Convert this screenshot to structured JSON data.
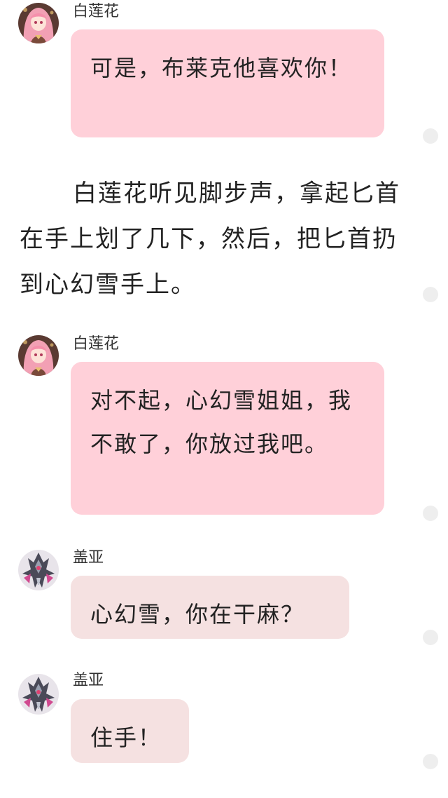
{
  "messages": [
    {
      "sender": "白莲花",
      "text": "可是，布莱克他喜欢你！",
      "avatar_icon": "pink-hair-girl-avatar-icon",
      "bubble_color": "#ffd0d9"
    },
    {
      "sender": "白莲花",
      "text": "对不起，心幻雪姐姐，我不敢了，你放过我吧。",
      "avatar_icon": "pink-hair-girl-avatar-icon",
      "bubble_color": "#ffd0d9"
    },
    {
      "sender": "盖亚",
      "text": "心幻雪，你在干麻？",
      "avatar_icon": "armored-robot-avatar-icon",
      "bubble_color": "#f5e1e1"
    },
    {
      "sender": "盖亚",
      "text": "住手！",
      "avatar_icon": "armored-robot-avatar-icon",
      "bubble_color": "#f5e1e1"
    }
  ],
  "narration": "白莲花听见脚步声，拿起匕首在手上划了几下，然后，把匕首扔到心幻雪手上。"
}
